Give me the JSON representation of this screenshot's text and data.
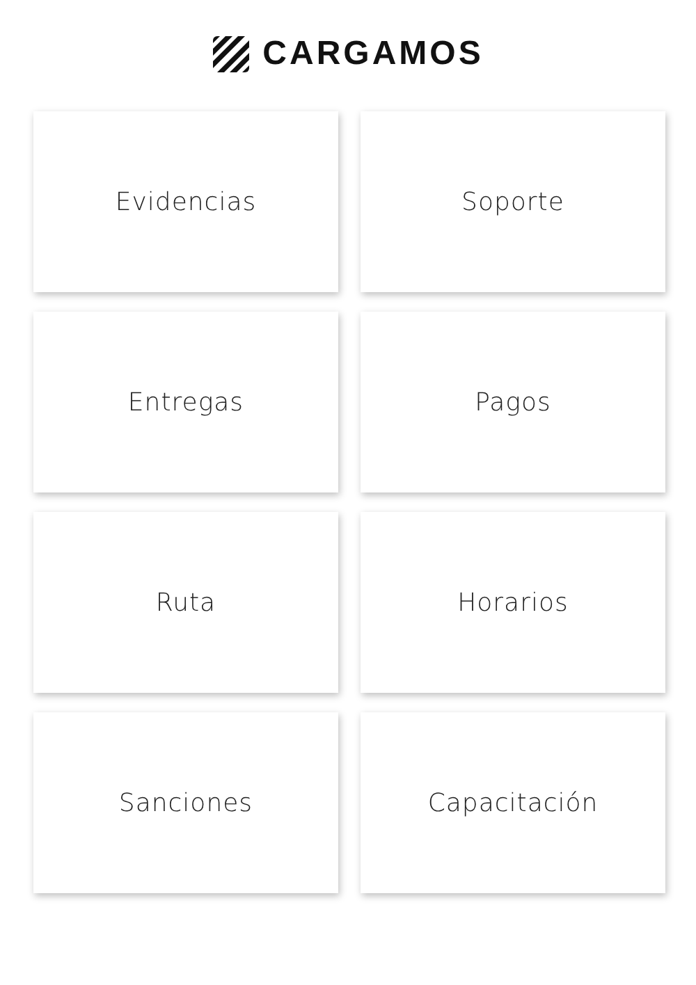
{
  "logo": {
    "text": "CARGAMOS"
  },
  "tiles": [
    {
      "label": "Evidencias"
    },
    {
      "label": "Soporte"
    },
    {
      "label": "Entregas"
    },
    {
      "label": "Pagos"
    },
    {
      "label": "Ruta"
    },
    {
      "label": "Horarios"
    },
    {
      "label": "Sanciones"
    },
    {
      "label": "Capacitación"
    }
  ]
}
